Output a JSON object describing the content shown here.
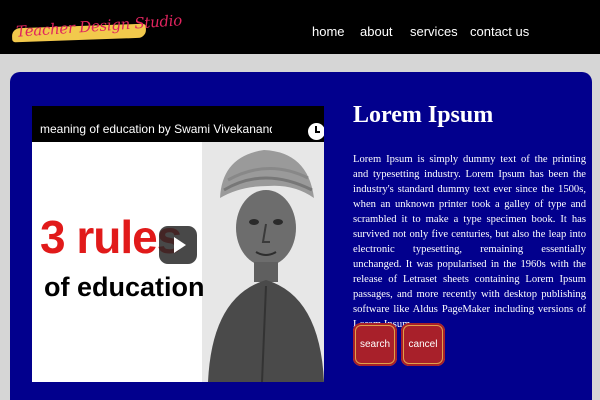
{
  "brand": {
    "logo_text": "Teacher Design Studio"
  },
  "nav": {
    "items": [
      "home",
      "about",
      "services",
      "contact us"
    ]
  },
  "video": {
    "title": "meaning of education by Swami Vivekanand | M...",
    "big_text": "3 rules",
    "sub_text": "of education"
  },
  "content": {
    "heading": "Lorem Ipsum",
    "body": "Lorem Ipsum is simply dummy text of the printing and typesetting industry. Lorem Ipsum has been the industry's standard dummy text ever since the 1500s, when an unknown printer took a galley of type and scrambled it to make a type specimen book. It has survived not only five centuries, but also the leap into electronic typesetting, remaining essentially unchanged. It was popularised in the 1960s with the release of Letraset sheets containing Lorem Ipsum passages, and more recently with desktop publishing software like Aldus PageMaker including versions of Lorem Ipsum.."
  },
  "buttons": {
    "search": "search",
    "cancel": "cancel"
  },
  "colors": {
    "navbar": "#000000",
    "page_background": "#d6d6d6",
    "panel": "#02008d",
    "button": "#a8202a",
    "logo_swoosh": "#f2c94c",
    "logo_text": "#e0245e",
    "video_accent": "#e11a1a"
  }
}
